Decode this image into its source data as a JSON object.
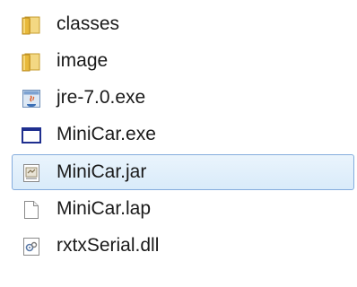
{
  "files": [
    {
      "name": "classes",
      "icon": "folder-icon",
      "selected": false
    },
    {
      "name": "image",
      "icon": "folder-icon",
      "selected": false
    },
    {
      "name": "jre-7.0.exe",
      "icon": "java-installer-icon",
      "selected": false
    },
    {
      "name": "MiniCar.exe",
      "icon": "application-window-icon",
      "selected": false
    },
    {
      "name": "MiniCar.jar",
      "icon": "jar-file-icon",
      "selected": true
    },
    {
      "name": "MiniCar.lap",
      "icon": "blank-file-icon",
      "selected": false
    },
    {
      "name": "rxtxSerial.dll",
      "icon": "dll-file-icon",
      "selected": false
    }
  ],
  "colors": {
    "selection_background": "#d9ebfa",
    "selection_border": "#84acdd",
    "folder": "#e8b93a",
    "app_window_frame": "#1f2f8f"
  }
}
